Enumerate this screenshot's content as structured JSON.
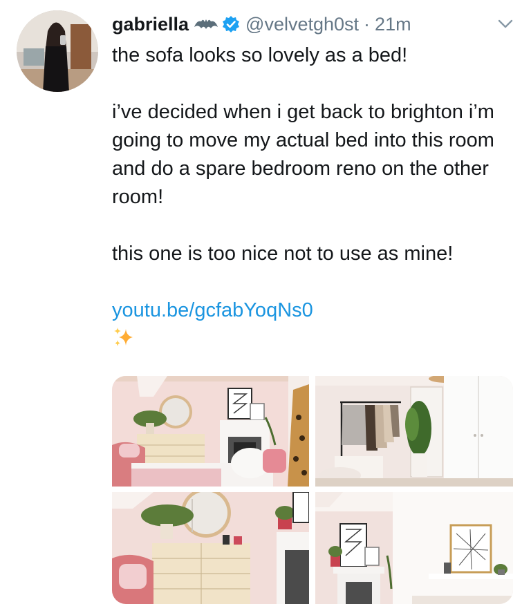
{
  "tweet": {
    "display_name": "gabriella",
    "name_emoji": "bat",
    "verified": true,
    "handle": "@velvetgh0st",
    "separator": "·",
    "time": "21m",
    "paragraphs": [
      "the sofa looks so lovely as a bed!",
      "i’ve decided when i get back to brighton i’m going to move my actual bed into this room and do a spare bedroom reno on the other room!",
      "this one is too nice not to use as mine!"
    ],
    "link": "youtu.be/gcfabYoqNs0",
    "trailing_emoji": "sparkles"
  },
  "icons": {
    "avatar": "profile-photo",
    "verified": "verified-badge-icon",
    "menu": "chevron-down-icon",
    "bat": "bat-icon",
    "sparkles": "sparkles-icon"
  },
  "colors": {
    "text": "#14171a",
    "muted": "#657786",
    "link": "#1b95e0",
    "verified": "#1da1f2",
    "sparkles": "#ffac33"
  },
  "media": [
    {
      "description": "bedroom-with-mirror-and-dresser"
    },
    {
      "description": "clothes-rail-and-wardrobe"
    },
    {
      "description": "pink-chair-and-dresser"
    },
    {
      "description": "fireplace-and-framed-map"
    }
  ]
}
